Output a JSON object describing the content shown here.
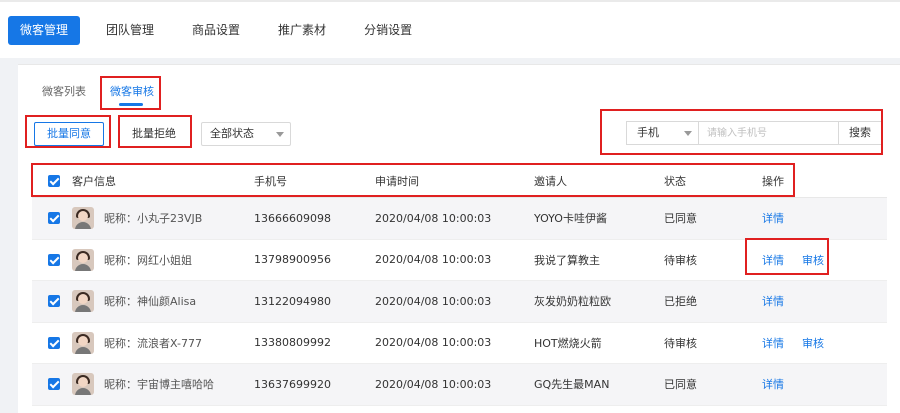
{
  "nav": {
    "items": [
      {
        "label": "微客管理",
        "active": true
      },
      {
        "label": "团队管理",
        "active": false
      },
      {
        "label": "商品设置",
        "active": false
      },
      {
        "label": "推广素材",
        "active": false
      },
      {
        "label": "分销设置",
        "active": false
      }
    ]
  },
  "subtabs": [
    {
      "label": "微客列表",
      "active": false
    },
    {
      "label": "微客审核",
      "active": true
    }
  ],
  "toolbar": {
    "approve_label": "批量同意",
    "reject_label": "批量拒绝",
    "status_selected": "全部状态"
  },
  "search": {
    "type_selected": "手机",
    "placeholder": "请输入手机号",
    "button_label": "搜索"
  },
  "table": {
    "headers": {
      "customer": "客户信息",
      "phone": "手机号",
      "time": "申请时间",
      "inviter": "邀请人",
      "status": "状态",
      "ops": "操作"
    },
    "detail_label": "详情",
    "review_label": "审核",
    "rows": [
      {
        "nickname": "昵称：小丸子23VJB",
        "phone": "13666609098",
        "time": "2020/04/08 10:00:03",
        "inviter": "YOYO卡哇伊酱",
        "status": "已同意",
        "reviewable": false
      },
      {
        "nickname": "昵称：网红小姐姐",
        "phone": "13798900956",
        "time": "2020/04/08 10:00:03",
        "inviter": "我说了算教主",
        "status": "待审核",
        "reviewable": true
      },
      {
        "nickname": "昵称：神仙颜Alisa",
        "phone": "13122094980",
        "time": "2020/04/08 10:00:03",
        "inviter": "灰发奶奶粒粒欧",
        "status": "已拒绝",
        "reviewable": false
      },
      {
        "nickname": "昵称：流浪者X-777",
        "phone": "13380809992",
        "time": "2020/04/08 10:00:03",
        "inviter": "HOT燃烧火箭",
        "status": "待审核",
        "reviewable": true
      },
      {
        "nickname": "昵称：宇宙博主嘻哈哈",
        "phone": "13637699920",
        "time": "2020/04/08 10:00:03",
        "inviter": "GQ先生最MAN",
        "status": "已同意",
        "reviewable": false
      }
    ]
  },
  "colors": {
    "accent": "#1677e6",
    "annotation": "#e02020"
  }
}
